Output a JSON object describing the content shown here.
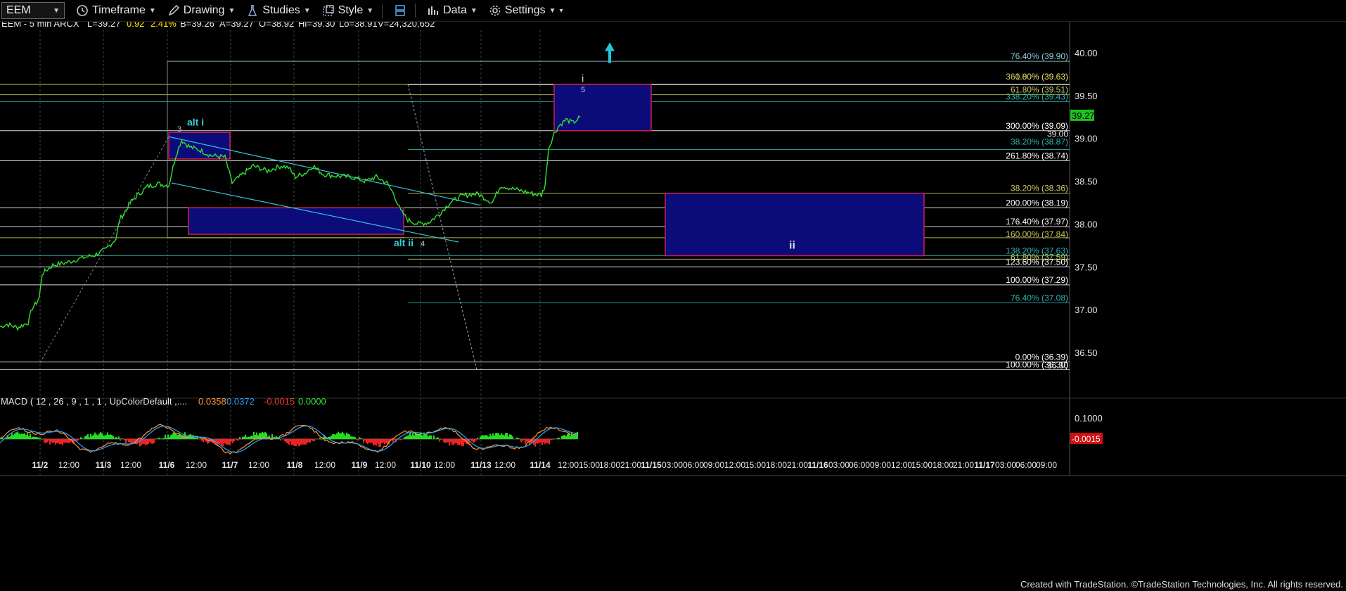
{
  "toolbar": {
    "symbol": "EEM",
    "buttons": [
      {
        "label": "Timeframe",
        "icon": "clock-icon"
      },
      {
        "label": "Drawing",
        "icon": "pencil-icon"
      },
      {
        "label": "Studies",
        "icon": "flask-icon"
      },
      {
        "label": "Style",
        "icon": "style-icon"
      },
      {
        "label": "",
        "icon": "layout-icon"
      },
      {
        "label": "Data",
        "icon": "bar-chart-icon"
      },
      {
        "label": "Settings",
        "icon": "gear-icon"
      }
    ]
  },
  "header": {
    "symbol_info": "EEM - 5 min  ARCX",
    "last": "L=39.27",
    "change": "0.92",
    "change_pct": "2.41%",
    "bid": "B=39.26",
    "ask": "A=39.27",
    "open": "O=38.92",
    "high": "Hi=39.30",
    "low": "Lo=38.91",
    "volume": "V=24,320,652"
  },
  "macd_header": {
    "label": "MACD ( 12 , 26 , 9 , 1 , 1 , UpColorDefault ,....",
    "v1": "0.0358",
    "v2": "0.0372",
    "v3": "-0.0015",
    "v4": "0.0000"
  },
  "credit": "Created with TradeStation. ©TradeStation Technologies, Inc. All rights reserved.",
  "chart_data": {
    "type": "line",
    "title": "EEM - 5 min",
    "y_axis": {
      "range": [
        36.3,
        40.15
      ],
      "ticks": [
        "40.00",
        "39.50",
        "39.00",
        "38.50",
        "38.00",
        "37.50",
        "37.00",
        "36.50"
      ]
    },
    "x_ticks": [
      "11/2",
      "12:00",
      "11/3",
      "12:00",
      "11/6",
      "12:00",
      "11/7",
      "12:00",
      "11/8",
      "12:00",
      "11/9",
      "12:00",
      "11/10",
      "12:00",
      "11/13",
      "12:00",
      "11/14",
      "12:00",
      "15:00",
      "18:00",
      "21:00",
      "11/15",
      "03:00",
      "06:00",
      "09:00",
      "12:00",
      "15:00",
      "18:00",
      "21:00",
      "11/16",
      "03:00",
      "06:00",
      "09:00",
      "12:00",
      "15:00",
      "18:00",
      "21:00",
      "11/17",
      "03:00",
      "06:00",
      "09:00"
    ],
    "price_series": [
      [
        0,
        36.8
      ],
      [
        10,
        36.83
      ],
      [
        25,
        36.79
      ],
      [
        40,
        36.85
      ],
      [
        46,
        37.02
      ],
      [
        52,
        37.08
      ],
      [
        56,
        37.15
      ],
      [
        60,
        37.42
      ],
      [
        75,
        37.52
      ],
      [
        95,
        37.55
      ],
      [
        115,
        37.6
      ],
      [
        135,
        37.64
      ],
      [
        150,
        37.7
      ],
      [
        165,
        37.83
      ],
      [
        170,
        38.05
      ],
      [
        178,
        38.15
      ],
      [
        185,
        38.25
      ],
      [
        195,
        38.33
      ],
      [
        210,
        38.44
      ],
      [
        225,
        38.47
      ],
      [
        240,
        38.45
      ],
      [
        250,
        38.8
      ],
      [
        258,
        38.98
      ],
      [
        270,
        38.9
      ],
      [
        285,
        38.86
      ],
      [
        300,
        38.8
      ],
      [
        320,
        38.78
      ],
      [
        330,
        38.48
      ],
      [
        345,
        38.58
      ],
      [
        360,
        38.68
      ],
      [
        380,
        38.62
      ],
      [
        400,
        38.68
      ],
      [
        410,
        38.66
      ],
      [
        420,
        38.55
      ],
      [
        435,
        38.6
      ],
      [
        445,
        38.68
      ],
      [
        460,
        38.58
      ],
      [
        480,
        38.56
      ],
      [
        500,
        38.55
      ],
      [
        520,
        38.5
      ],
      [
        535,
        38.55
      ],
      [
        550,
        38.48
      ],
      [
        560,
        38.35
      ],
      [
        570,
        38.15
      ],
      [
        580,
        38.05
      ],
      [
        595,
        38.0
      ],
      [
        610,
        38.02
      ],
      [
        625,
        38.12
      ],
      [
        640,
        38.25
      ],
      [
        655,
        38.32
      ],
      [
        670,
        38.35
      ],
      [
        680,
        38.35
      ],
      [
        690,
        38.3
      ],
      [
        700,
        38.25
      ],
      [
        712,
        38.45
      ],
      [
        725,
        38.42
      ],
      [
        745,
        38.38
      ],
      [
        760,
        38.35
      ],
      [
        770,
        38.34
      ],
      [
        775,
        38.45
      ],
      [
        780,
        38.88
      ],
      [
        788,
        39.06
      ],
      [
        795,
        39.15
      ],
      [
        805,
        39.22
      ],
      [
        815,
        39.18
      ],
      [
        825,
        39.25
      ]
    ],
    "fib_levels": [
      {
        "label": "76.40% (39.90)",
        "value": 39.9,
        "color": "#8fd1db"
      },
      {
        "label": "0.00% (39.63)",
        "value": 39.63,
        "color": "#c8c860"
      },
      {
        "label": "361.80% (39.63)",
        "value": 39.63,
        "color": "#c8c860"
      },
      {
        "label": "61.80% (39.51)",
        "value": 39.51,
        "color": "#c8c860"
      },
      {
        "label": "338.20% (39.43)",
        "value": 39.43,
        "color": "#2fb2b2"
      },
      {
        "label": "300.00% (39.09)",
        "value": 39.09,
        "color": "#ffffff"
      },
      {
        "label": "38.20% (38.87)",
        "value": 38.87,
        "color": "#2fb2b2"
      },
      {
        "label": "261.80% (38.74)",
        "value": 38.74,
        "color": "#ffffff"
      },
      {
        "label": "38.20% (38.36)",
        "value": 38.36,
        "color": "#c8c860"
      },
      {
        "label": "200.00% (38.19)",
        "value": 38.19,
        "color": "#ffffff"
      },
      {
        "label": "176.40% (37.97)",
        "value": 37.97,
        "color": "#ffffff"
      },
      {
        "label": "160.00% (37.84)",
        "value": 37.84,
        "color": "#c8c860"
      },
      {
        "label": "138.20% (37.63)",
        "value": 37.63,
        "color": "#2fb2b2"
      },
      {
        "label": "61.80% (37.59)",
        "value": 37.59,
        "color": "#c8c860"
      },
      {
        "label": "123.60% (37.50)",
        "value": 37.5,
        "color": "#ffffff"
      },
      {
        "label": "100.00% (37.29)",
        "value": 37.29,
        "color": "#ffffff"
      },
      {
        "label": "76.40% (37.08)",
        "value": 37.08,
        "color": "#2fb2b2"
      },
      {
        "label": "0.00% (36.39)",
        "value": 36.39,
        "color": "#ffffff"
      },
      {
        "label": "100.00% (36.30)",
        "value": 36.3,
        "color": "#ffffff"
      }
    ],
    "right_axis_labels": [
      {
        "label": "39.00",
        "value": 39.0
      },
      {
        "label": "36.30",
        "value": 36.3
      }
    ],
    "last_price": {
      "label": "39.27",
      "value": 39.27
    },
    "annotations": [
      {
        "text": "alt i",
        "color": "#35d0e0"
      },
      {
        "text": "3",
        "color": "#cccccc"
      },
      {
        "text": "alt ii",
        "color": "#35d0e0"
      },
      {
        "text": "4",
        "color": "#cccccc"
      },
      {
        "text": "i",
        "color": "#cccccc"
      },
      {
        "text": "5",
        "color": "#cccccc"
      },
      {
        "text": "ii",
        "color": "#dddddd"
      }
    ],
    "macd": {
      "axis_labels": [
        "0.1000",
        "-0.0015"
      ],
      "values": [
        0.0358,
        0.0372,
        -0.0015,
        0.0
      ]
    },
    "colors": {
      "price": "#33e033",
      "box_fill": "#0b0b7a",
      "box_border": "#cc1f4f",
      "arrow": "#22c8d8"
    }
  }
}
